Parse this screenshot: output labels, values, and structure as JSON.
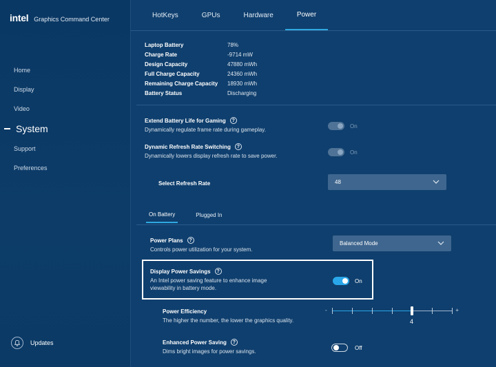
{
  "app": {
    "logo": "intel",
    "name": "Graphics Command Center"
  },
  "sidebar": {
    "items": [
      {
        "label": "Home"
      },
      {
        "label": "Display"
      },
      {
        "label": "Video"
      },
      {
        "label": "System",
        "active": true
      },
      {
        "label": "Support"
      },
      {
        "label": "Preferences"
      }
    ],
    "updates_label": "Updates"
  },
  "tabs": [
    {
      "label": "HotKeys"
    },
    {
      "label": "GPUs"
    },
    {
      "label": "Hardware"
    },
    {
      "label": "Power",
      "active": true
    }
  ],
  "battery_info": [
    {
      "label": "Laptop Battery",
      "value": "78%"
    },
    {
      "label": "Charge Rate",
      "value": "-9714 mW"
    },
    {
      "label": "Design Capacity",
      "value": "47880 mWh"
    },
    {
      "label": "Full Charge Capacity",
      "value": "24360 mWh"
    },
    {
      "label": "Remaining Charge Capacity",
      "value": "18930 mWh"
    },
    {
      "label": "Battery Status",
      "value": "Discharging"
    }
  ],
  "extend_battery": {
    "title": "Extend Battery Life for Gaming",
    "desc": "Dynamically regulate frame rate during gameplay.",
    "state": "On"
  },
  "dynamic_refresh": {
    "title": "Dynamic Refresh Rate Switching",
    "desc": "Dynamically lowers display refresh rate to save power.",
    "state": "On"
  },
  "refresh_rate": {
    "label": "Select Refresh Rate",
    "value": "48"
  },
  "subtabs": [
    {
      "label": "On Battery",
      "active": true
    },
    {
      "label": "Plugged In"
    }
  ],
  "power_plans": {
    "title": "Power Plans",
    "desc": "Controls power utilization for your system.",
    "value": "Balanced Mode"
  },
  "display_power_savings": {
    "title": "Display Power Savings",
    "desc_line1": "An Intel power saving feature to enhance image",
    "desc_line2": "viewability in battery mode.",
    "state": "On"
  },
  "power_efficiency": {
    "title": "Power Efficiency",
    "desc": "The higher the number, the lower the graphics quality.",
    "min_label": "-",
    "max_label": "+",
    "value": "4",
    "level": 4,
    "steps": 6
  },
  "enhanced_power_saving": {
    "title": "Enhanced Power Saving",
    "desc": "Dims bright images for power savings.",
    "state": "Off"
  },
  "help_glyph": "?",
  "colors": {
    "background": "#0f3f6e",
    "sidebar": "#0a3864",
    "accent": "#2aa7ea",
    "select": "#3f668e"
  }
}
